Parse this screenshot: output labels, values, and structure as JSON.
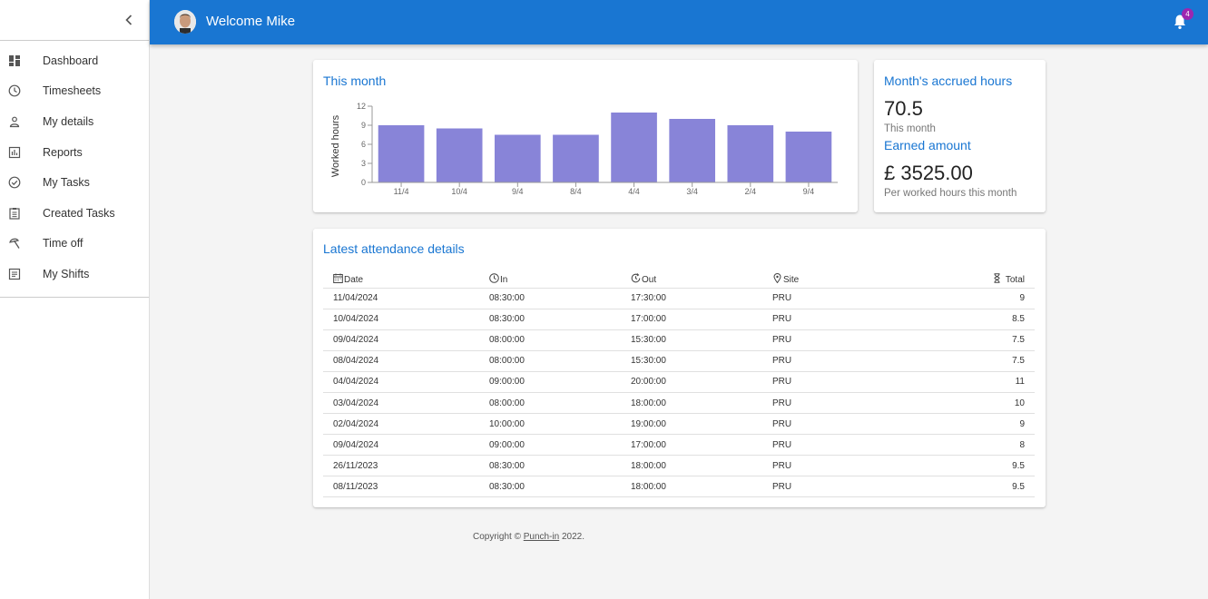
{
  "header": {
    "welcome": "Welcome Mike",
    "notification_count": "4",
    "accent": "#1976d2"
  },
  "sidebar": {
    "items": [
      {
        "label": "Dashboard",
        "icon": "dashboard-icon"
      },
      {
        "label": "Timesheets",
        "icon": "clock-icon"
      },
      {
        "label": "My details",
        "icon": "person-icon"
      },
      {
        "label": "Reports",
        "icon": "bar-chart-icon"
      },
      {
        "label": "My Tasks",
        "icon": "check-circle-icon"
      },
      {
        "label": "Created Tasks",
        "icon": "clipboard-icon"
      },
      {
        "label": "Time off",
        "icon": "beach-icon"
      },
      {
        "label": "My Shifts",
        "icon": "list-icon"
      }
    ]
  },
  "chart_card": {
    "title": "This month"
  },
  "chart_data": {
    "type": "bar",
    "categories": [
      "11/4",
      "10/4",
      "9/4",
      "8/4",
      "4/4",
      "3/4",
      "2/4",
      "9/4"
    ],
    "values": [
      9,
      8.5,
      7.5,
      7.5,
      11,
      10,
      9,
      8
    ],
    "ylabel": "Worked hours",
    "ylim": [
      0,
      12
    ],
    "yticks": [
      0,
      3,
      6,
      9,
      12
    ],
    "bar_color": "#8884d8"
  },
  "accrued": {
    "title": "Month's accrued hours",
    "hours": "70.5",
    "hours_sub": "This month",
    "earned_title": "Earned amount",
    "earned": "£ 3525.00",
    "earned_sub": "Per worked hours this month"
  },
  "attendance": {
    "title": "Latest attendance details",
    "columns": [
      "Date",
      "In",
      "Out",
      "Site",
      "Total"
    ],
    "rows": [
      [
        "11/04/2024",
        "08:30:00",
        "17:30:00",
        "PRU",
        "9"
      ],
      [
        "10/04/2024",
        "08:30:00",
        "17:00:00",
        "PRU",
        "8.5"
      ],
      [
        "09/04/2024",
        "08:00:00",
        "15:30:00",
        "PRU",
        "7.5"
      ],
      [
        "08/04/2024",
        "08:00:00",
        "15:30:00",
        "PRU",
        "7.5"
      ],
      [
        "04/04/2024",
        "09:00:00",
        "20:00:00",
        "PRU",
        "11"
      ],
      [
        "03/04/2024",
        "08:00:00",
        "18:00:00",
        "PRU",
        "10"
      ],
      [
        "02/04/2024",
        "10:00:00",
        "19:00:00",
        "PRU",
        "9"
      ],
      [
        "09/04/2024",
        "09:00:00",
        "17:00:00",
        "PRU",
        "8"
      ],
      [
        "26/11/2023",
        "08:30:00",
        "18:00:00",
        "PRU",
        "9.5"
      ],
      [
        "08/11/2023",
        "08:30:00",
        "18:00:00",
        "PRU",
        "9.5"
      ]
    ]
  },
  "footer": {
    "prefix": "Copyright © ",
    "link": "Punch-in",
    "suffix": " 2022."
  }
}
